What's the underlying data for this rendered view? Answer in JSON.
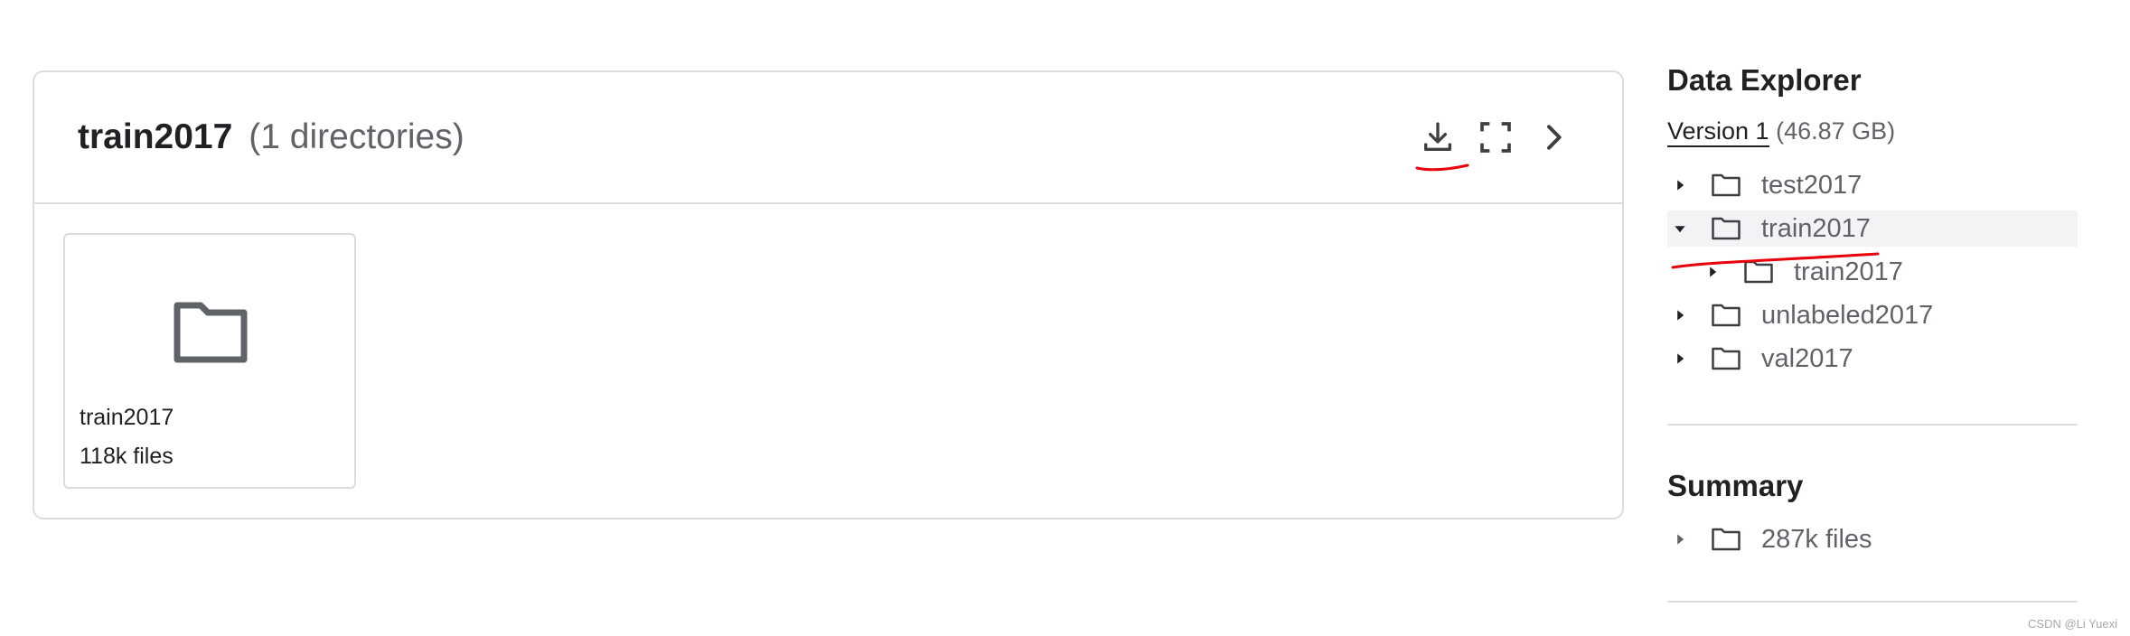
{
  "panel": {
    "title": "train2017",
    "subtitle": "(1 directories)",
    "actions": [
      {
        "name": "download-icon"
      },
      {
        "name": "fullscreen-icon"
      },
      {
        "name": "chevron-right-icon"
      }
    ],
    "card": {
      "icon": "folder-icon",
      "name": "train2017",
      "count": "118k files"
    }
  },
  "sidebar": {
    "title": "Data Explorer",
    "version_link": "Version 1",
    "version_size": "(46.87 GB)",
    "tree": [
      {
        "label": "test2017",
        "expanded": false,
        "level": 0,
        "selected": false
      },
      {
        "label": "train2017",
        "expanded": true,
        "level": 0,
        "selected": true
      },
      {
        "label": "train2017",
        "expanded": false,
        "level": 1,
        "selected": false
      },
      {
        "label": "unlabeled2017",
        "expanded": false,
        "level": 0,
        "selected": false
      },
      {
        "label": "val2017",
        "expanded": false,
        "level": 0,
        "selected": false
      }
    ],
    "summary": {
      "title": "Summary",
      "label": "287k files"
    }
  },
  "watermark": "CSDN @Li Yuexi",
  "colors": {
    "border": "#dadce0",
    "text": "#202124",
    "muted": "#5f6368",
    "selected_bg": "#f1f3f4",
    "annotation_ink": "#e8000b"
  }
}
